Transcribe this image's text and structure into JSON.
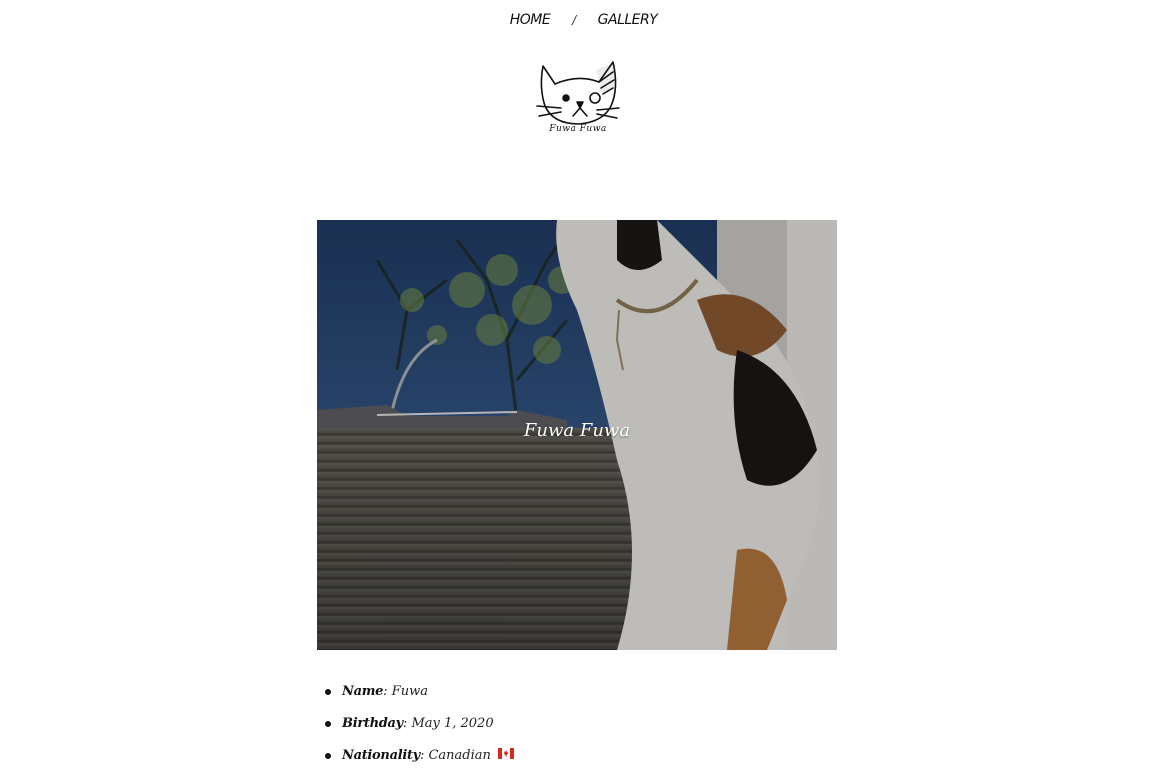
{
  "nav": {
    "home": "HOME",
    "separator": "/",
    "gallery": "GALLERY"
  },
  "logo": {
    "caption": "Fuwa Fuwa",
    "icon": "cat-face-logo"
  },
  "hero": {
    "title": "Fuwa Fuwa",
    "image": "calico-cat-at-window-photo"
  },
  "facts": [
    {
      "key": "Name",
      "sep": ":",
      "value": "Fuwa"
    },
    {
      "key": "Birthday",
      "sep": ":",
      "value": "May 1, 2020"
    },
    {
      "key": "Nationality",
      "sep": ":",
      "value": "Canadian",
      "flag_icon": "canada-flag-icon"
    }
  ],
  "colors": {
    "flag_red": "#d52b1e",
    "sky": "#2f4e7a",
    "fence": "#6f6a5c"
  }
}
